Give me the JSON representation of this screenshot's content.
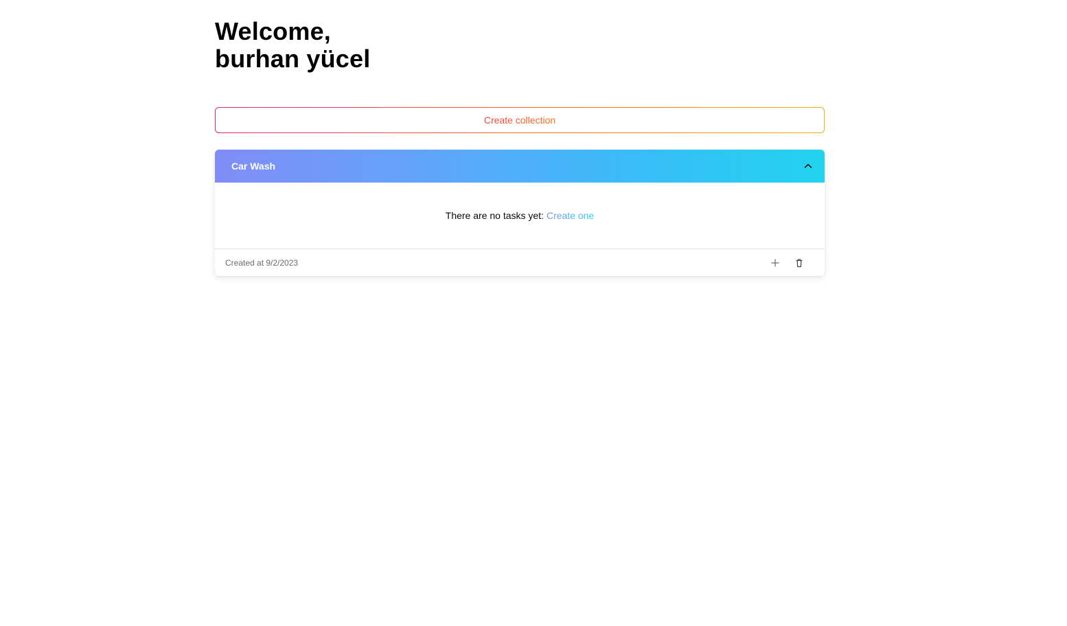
{
  "greeting": {
    "line1": "Welcome,",
    "line2": "burhan yücel"
  },
  "actions": {
    "create_collection_label": "Create collection"
  },
  "collections": [
    {
      "name": "Car Wash",
      "expanded": true,
      "empty_message": "There are no tasks yet:",
      "empty_link": "Create one",
      "created_at": "Created at 9/2/2023",
      "footer_icons": [
        "plus-icon",
        "trash-icon"
      ]
    }
  ],
  "colors": {
    "create_border_gradient": [
      "#db2777",
      "#f97316",
      "#eab308"
    ],
    "header_gradient": [
      "#818cf8",
      "#60a5fa",
      "#38bdf8",
      "#22d3ee"
    ],
    "text_primary": "#0a0a0a",
    "text_muted": "#6b6b6b"
  }
}
